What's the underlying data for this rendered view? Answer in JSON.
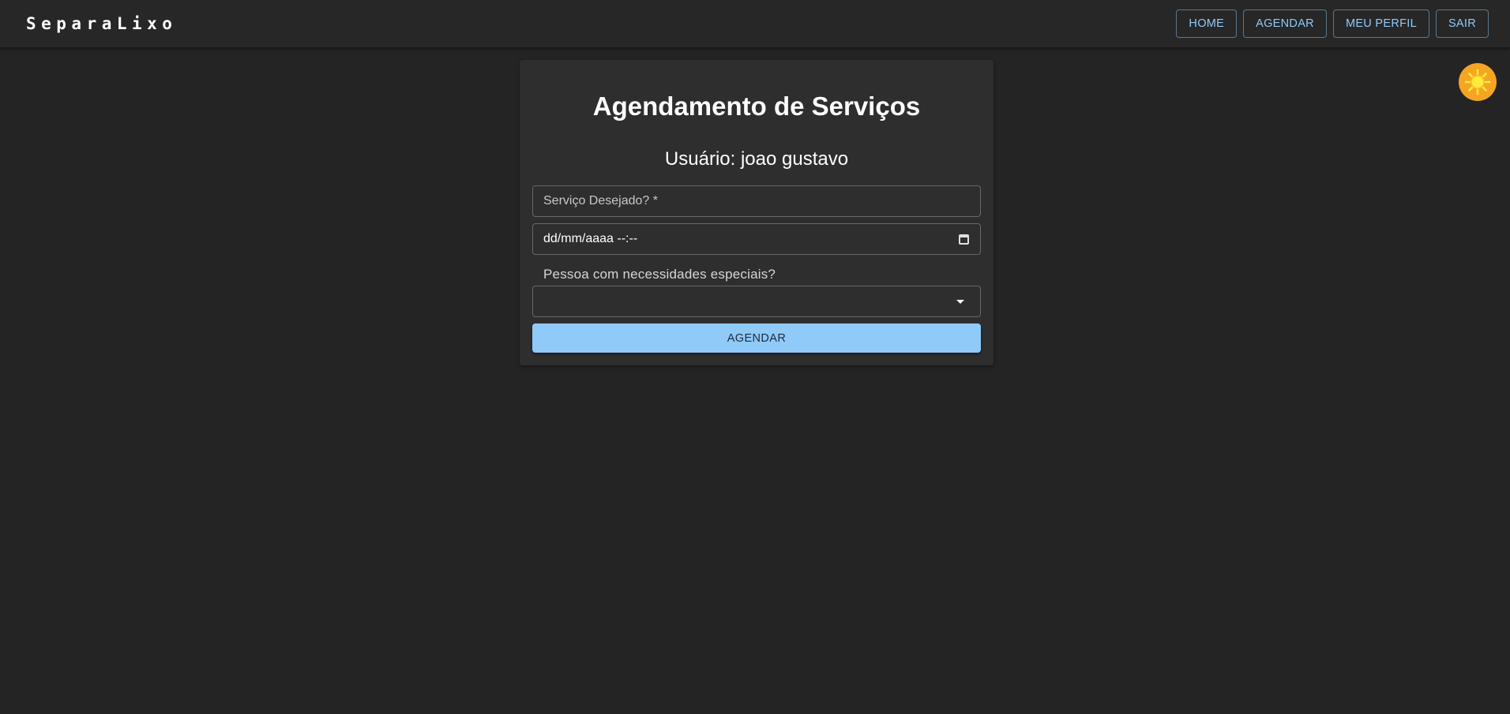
{
  "app": {
    "brand": "SeparaLixo"
  },
  "nav": {
    "items": [
      {
        "label": "HOME"
      },
      {
        "label": "AGENDAR"
      },
      {
        "label": "MEU PERFIL"
      },
      {
        "label": "SAIR"
      }
    ]
  },
  "theme_toggle": {
    "icon": "sun-icon",
    "color": "#f5a524"
  },
  "form": {
    "title": "Agendamento de Serviços",
    "user_label": "Usuário:",
    "user_name": "joao gustavo",
    "service_placeholder": "Serviço Desejado? *",
    "datetime_placeholder": "dd/mm/aaaa --:--",
    "special_needs_label": "Pessoa com necessidades especiais?",
    "special_needs_value": "",
    "submit_label": "AGENDAR"
  },
  "colors": {
    "background": "#242424",
    "appbar": "#272727",
    "card": "#2e2e2e",
    "accent": "#90caf9"
  }
}
